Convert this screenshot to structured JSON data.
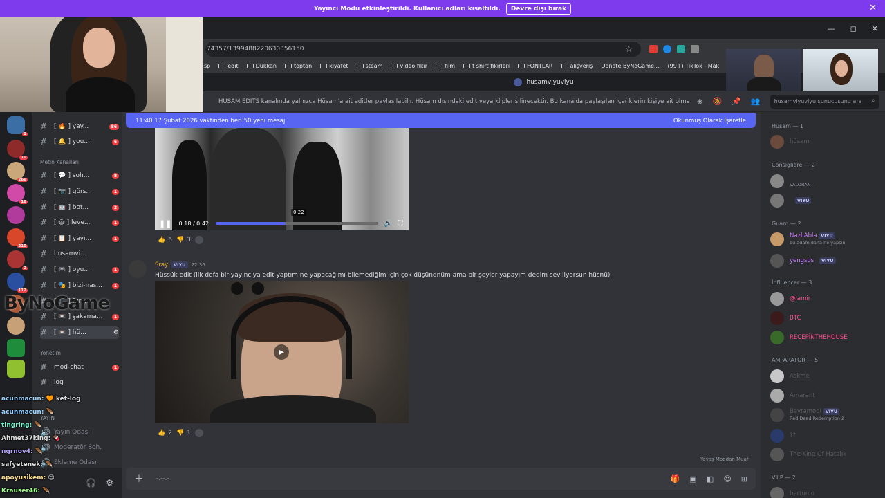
{
  "banner": {
    "text": "Yayıncı Modu etkinleştirildi. Kullanıcı adları kısaltıldı.",
    "button": "Devre dışı bırak",
    "close": "✕"
  },
  "browser": {
    "url": "74357/1399488220630356150",
    "bookmarks": [
      "sp",
      "edit",
      "Dükkan",
      "toptan",
      "kıyafet",
      "steam",
      "video fikir",
      "film",
      "t shirt fikirleri",
      "FONTLAR",
      "alışveriş",
      "Donate ByNoGame...",
      "(99+) TikTok - Mak"
    ],
    "window_controls": [
      "—",
      "◻",
      "✕"
    ]
  },
  "discord": {
    "server_name": "husamviyuviyu",
    "topic": "HÜSAM EDİTS kanalında yalnızca Hüsam'a ait editler paylaşılabilir. Hüsam dışındaki edit veya klipler silinecektir. Bu kanalda paylaşılan içeriklerin kişiye ait olması zorunl...",
    "search_placeholder": "husamviyuviyu sunucusunu ara",
    "new_messages_bar": {
      "text": "11:40 17 Şubat 2026 vaktinden beri 50 yeni mesaj",
      "action": "Okunmuş Olarak İşaretle"
    },
    "video1": {
      "time": "0:18 / 0:42",
      "tooltip": "0:22",
      "progress": 0.43
    },
    "msg1_reactions": [
      {
        "emoji": "👍",
        "count": "6"
      },
      {
        "emoji": "👎",
        "count": "3"
      }
    ],
    "msg2": {
      "author": "Sray",
      "badge": "VIYU",
      "time": "22:36",
      "text": "Hüssük edit (ilk defa bir yayıncıya edit yaptım ne yapacağımı bilemediğim için çok düşündnüm ama bir şeyler yapayım dedim seviliyorsun hüsnü)"
    },
    "msg2_reactions": [
      {
        "emoji": "👍",
        "count": "2"
      },
      {
        "emoji": "👎",
        "count": "1"
      }
    ],
    "input_placeholder": "-.--.-",
    "slowmode": "Yavaş Moddan Muaf",
    "channels": [
      {
        "label": "[ 🔥 ] yay...",
        "unread": "86"
      },
      {
        "label": "[ 🔔 ] you...",
        "unread": "6"
      },
      {
        "label": "[ 💬 ] soh...",
        "unread": "8"
      },
      {
        "label": "[ 📷 ] görs...",
        "unread": "1"
      },
      {
        "label": "[ 🤖 ] bot...",
        "unread": "2"
      },
      {
        "label": "[ 😺 ] leve...",
        "unread": "1"
      },
      {
        "label": "[ 📋 ] yayı...",
        "unread": "1"
      },
      {
        "label": "husamvi...",
        "unread": ""
      },
      {
        "label": "[ 🎮 ] oyu...",
        "unread": "1"
      },
      {
        "label": "[ 🎭 ] bizi-nas...",
        "unread": "1"
      },
      {
        "label": "[ 🎵 ] fun...",
        "unread": ""
      },
      {
        "label": "[ 📼 ] şakama...",
        "unread": "1"
      },
      {
        "label": "[ 📼 ] hü...",
        "unread": ""
      }
    ],
    "categories": {
      "text": "Metin Kanalları",
      "admin": "Yönetim",
      "stream": "YAYIN"
    },
    "admin_channels": [
      {
        "label": "mod-chat",
        "unread": "1"
      },
      {
        "label": "log",
        "unread": ""
      }
    ],
    "voice": [
      "Yayın Odası",
      "Moderatör Soh...",
      "Ekleme Odası"
    ],
    "members": {
      "roles": [
        {
          "name": "Hüsam — 1",
          "color": "#949ba4"
        },
        {
          "name": "Consigliere — 2",
          "color": "#949ba4"
        },
        {
          "name": "Guard — 2",
          "color": "#949ba4"
        },
        {
          "name": "İnfluencer — 3",
          "color": "#949ba4"
        },
        {
          "name": "AMPARATOR — 5",
          "color": "#949ba4"
        },
        {
          "name": "V.I.P — 2",
          "color": "#949ba4"
        }
      ],
      "people": [
        {
          "name": "hüsam",
          "sub": "",
          "color": "#5c5c5c",
          "badge": ""
        },
        {
          "name": "",
          "sub": "VALORANT",
          "color": "#5c5c5c",
          "badge": ""
        },
        {
          "name": "",
          "sub": "",
          "color": "#5c5c5c",
          "badge": "VIYU"
        },
        {
          "name": "NazlıAbla",
          "sub": "bu adam daha ne yapsın",
          "color": "#c77dff",
          "badge": "VIYU"
        },
        {
          "name": "yengsos",
          "sub": "",
          "color": "#c77dff",
          "badge": "VIYU"
        },
        {
          "name": "@lamir",
          "sub": "",
          "color": "#ff4d8d",
          "badge": ""
        },
        {
          "name": "BTC",
          "sub": "",
          "color": "#ff4d8d",
          "badge": ""
        },
        {
          "name": "RECEPİNTHEHOUSE",
          "sub": "",
          "color": "#ff4d8d",
          "badge": ""
        },
        {
          "name": "Askme",
          "sub": "",
          "color": "#5c5c5c",
          "badge": ""
        },
        {
          "name": "Amarant",
          "sub": "",
          "color": "#5c5c5c",
          "badge": ""
        },
        {
          "name": "Bayramogl",
          "sub": "Red Dead Redemption 2",
          "color": "#5c5c5c",
          "badge": "VIYU"
        },
        {
          "name": "??",
          "sub": "",
          "color": "#5c5c5c",
          "badge": ""
        },
        {
          "name": "The King Of Hatalık",
          "sub": "",
          "color": "#5c5c5c",
          "badge": ""
        },
        {
          "name": "berturco",
          "sub": "",
          "color": "#5c5c5c",
          "badge": ""
        }
      ]
    }
  },
  "twitch_chat": [
    {
      "user": "acunmacun:",
      "color": "#9ad3ff",
      "msg": "🧡 ket-log"
    },
    {
      "user": "acunmacun:",
      "color": "#9ad3ff",
      "msg": "🪶"
    },
    {
      "user": "tingring:",
      "color": "#7cf5d0",
      "msg": "🪶"
    },
    {
      "user": "Ahmet37king:",
      "color": "#dcdcdc",
      "msg": "🍫"
    },
    {
      "user": "ngrnov4:",
      "color": "#b6a6ff",
      "msg": "🪶"
    },
    {
      "user": "safyetenek:",
      "color": "#dcdcdc",
      "msg": "🪶"
    },
    {
      "user": "apoyusikem:",
      "color": "#ffe08a",
      "msg": "😊"
    },
    {
      "user": "Krauser46:",
      "color": "#9cff8a",
      "msg": "🪶"
    }
  ],
  "overlay_logo": "ByNoGame",
  "colors": {
    "accent": "#5865f2",
    "banner": "#7d3bed",
    "bg": "#313338"
  }
}
